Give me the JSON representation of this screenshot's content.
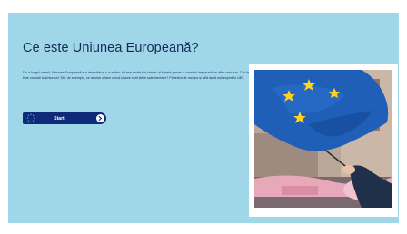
{
  "heading": "Ce este Uniunea Europeană?",
  "description": "De-a lungul vremii, Uniunea Europeană s-a dezvoltat și s-a extins, tot mai multe țări unindu-și forțele pentru a construi împreună un viitor mai bun. Cât de bine cunoști tu Uniunea? Știi, de exemplu, ce anume o face unică și care sunt țările sale membre? Fă testul de mai jos și află dacă ești expert în UE!",
  "start_button": {
    "label": "Start",
    "icon": "eu-stars-icon",
    "arrow_icon": "arrow-right-icon"
  },
  "image": {
    "subject": "eu-flag-photo"
  },
  "colors": {
    "panel_background": "#9fd6e8",
    "heading_text": "#152a57",
    "button_background": "#0f2a78",
    "flag_blue": "#1f5fb8",
    "flag_star": "#ffd21e"
  }
}
